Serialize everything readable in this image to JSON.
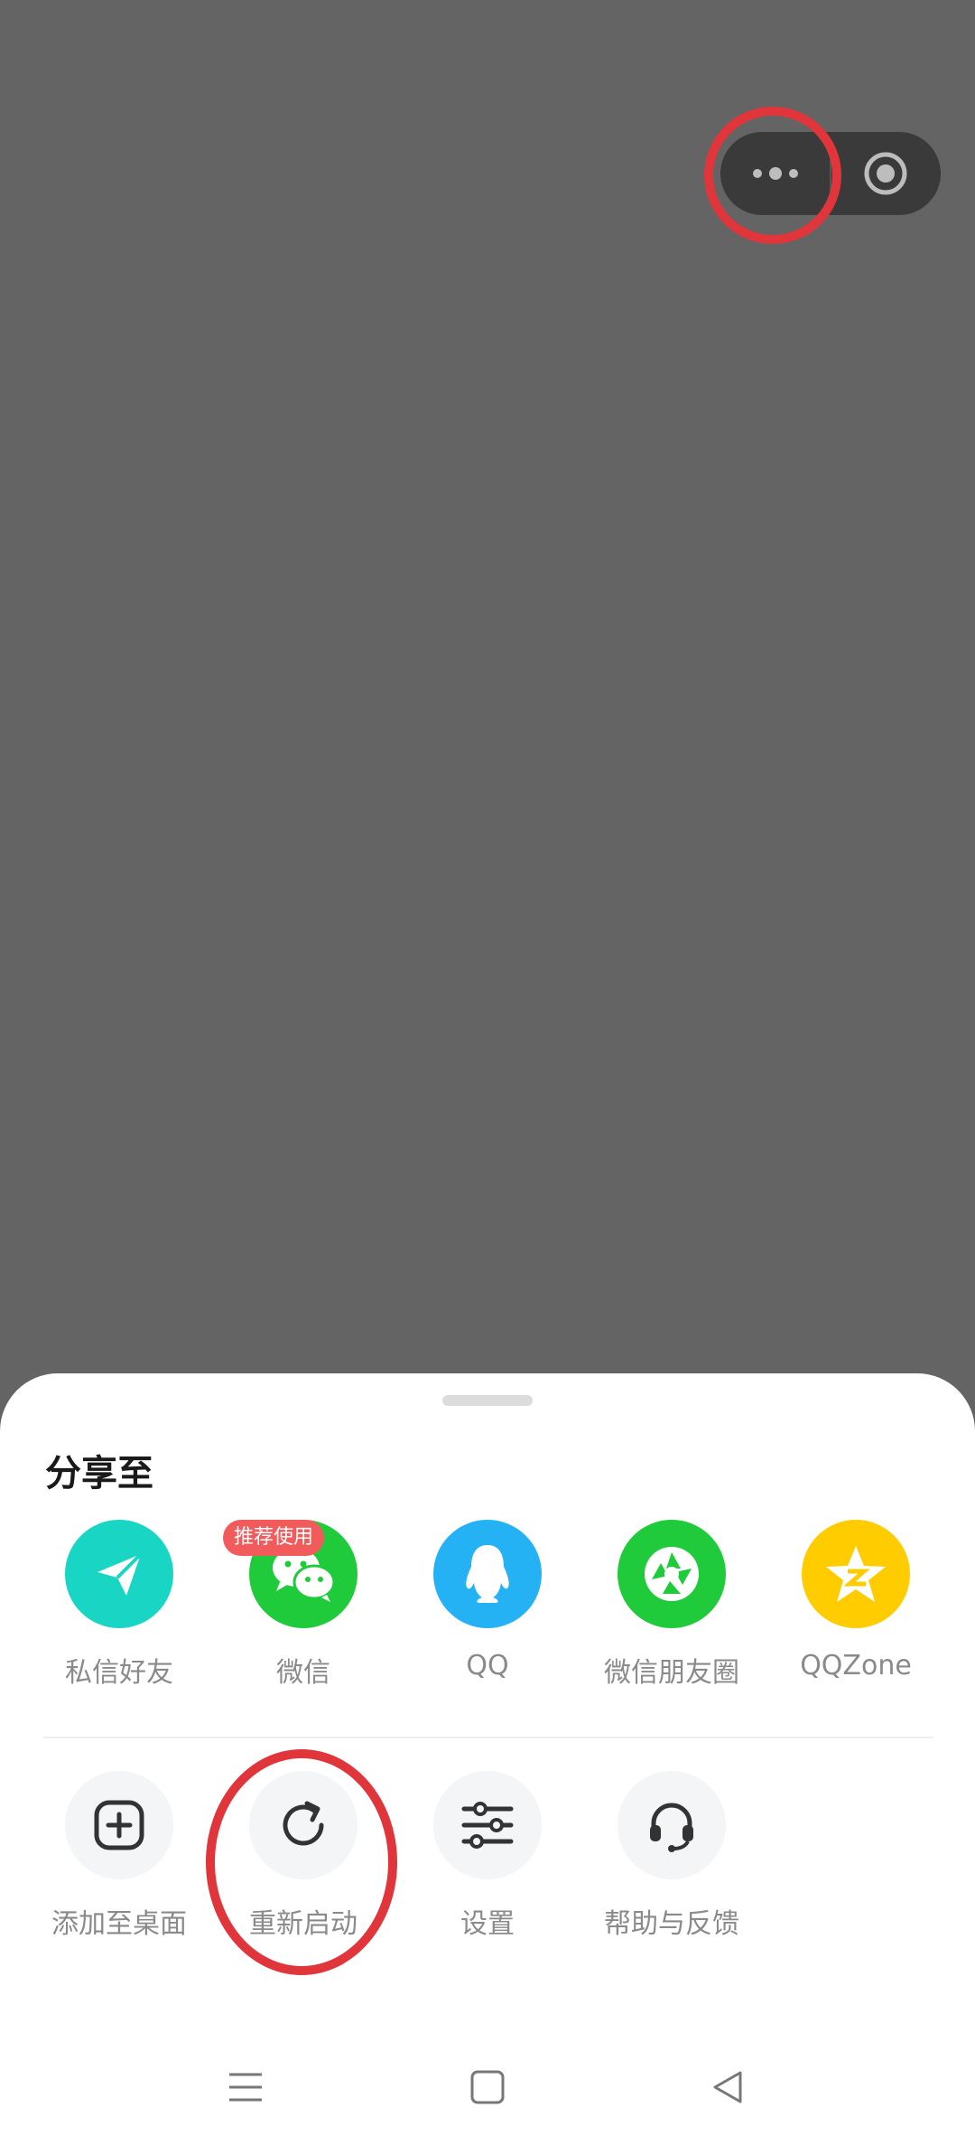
{
  "capsule": {
    "menu_icon": "more-dots-icon",
    "close_icon": "record-circle-icon"
  },
  "sheet": {
    "title": "分享至",
    "share_items": [
      {
        "label": "私信好友",
        "icon": "paper-plane-icon",
        "color": "#19d6c4"
      },
      {
        "label": "微信",
        "icon": "wechat-icon",
        "color": "#1fcb3b",
        "badge": "推荐使用"
      },
      {
        "label": "QQ",
        "icon": "qq-penguin-icon",
        "color": "#24b2f4"
      },
      {
        "label": "微信朋友圈",
        "icon": "moments-aperture-icon",
        "color": "#1fcb3b"
      },
      {
        "label": "QQZone",
        "icon": "qzone-star-icon",
        "color": "#ffcc00"
      }
    ],
    "action_items": [
      {
        "label": "添加至桌面",
        "icon": "add-square-icon"
      },
      {
        "label": "重新启动",
        "icon": "restart-icon"
      },
      {
        "label": "设置",
        "icon": "sliders-icon"
      },
      {
        "label": "帮助与反馈",
        "icon": "headset-icon"
      }
    ]
  },
  "navbar": {
    "menu_icon": "menu-lines-icon",
    "home_icon": "home-square-icon",
    "back_icon": "back-triangle-icon"
  },
  "colors": {
    "backdrop": "#646464",
    "annotation": "#e0363b",
    "badge": "#f25b5b"
  }
}
